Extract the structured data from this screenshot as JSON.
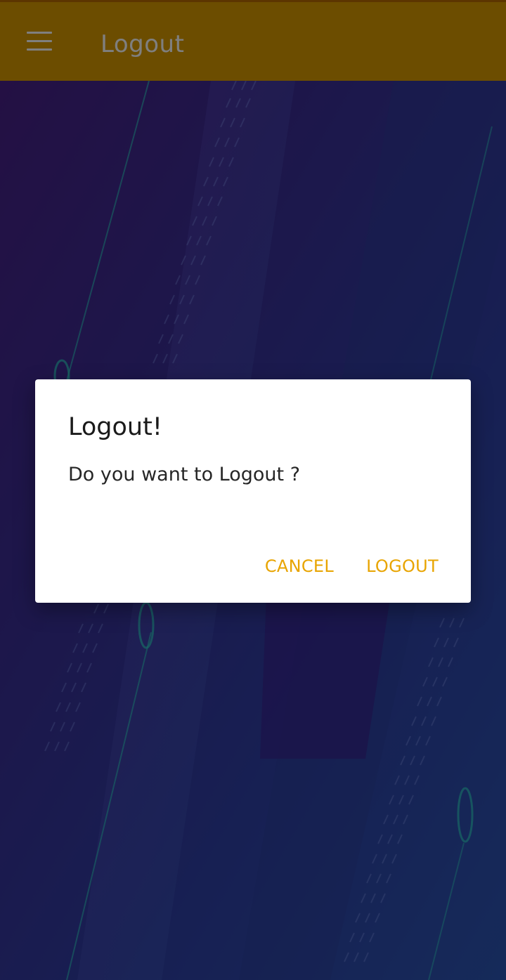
{
  "appbar": {
    "title": "Logout",
    "menu_icon": "menu-icon"
  },
  "dialog": {
    "title": "Logout!",
    "message": "Do you want to Logout ?",
    "cancel_label": "CANCEL",
    "logout_label": "LOGOUT"
  },
  "colors": {
    "appbar": "#d89a00",
    "accent": "#e8a400",
    "background_start": "#4a1f86",
    "background_end": "#2b55b4"
  }
}
